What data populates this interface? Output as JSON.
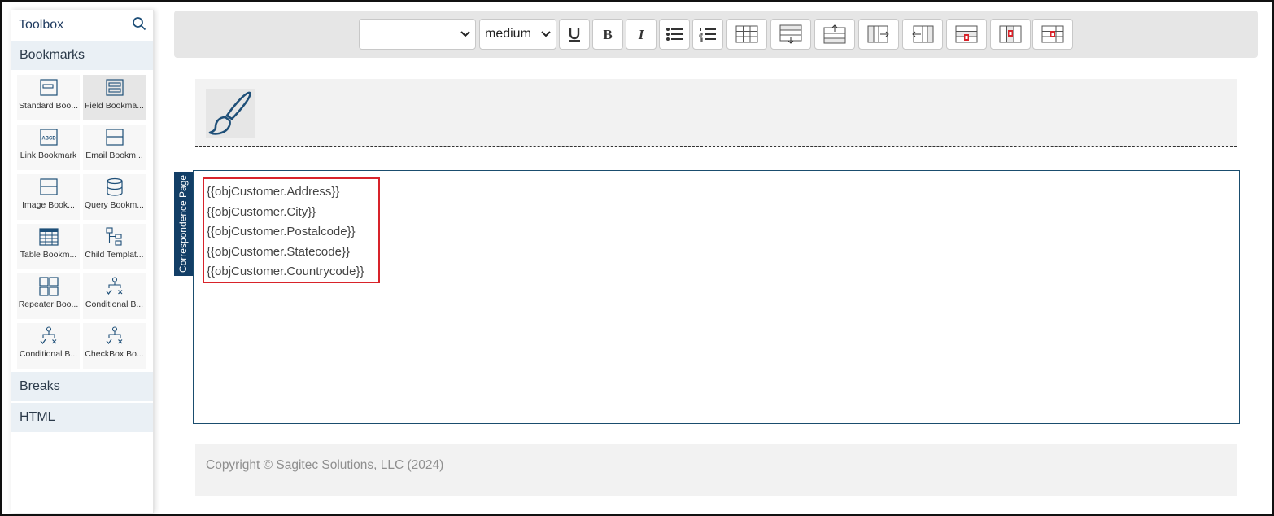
{
  "toolbox": {
    "title": "Toolbox",
    "sections": {
      "bookmarks": "Bookmarks",
      "breaks": "Breaks",
      "html": "HTML"
    },
    "items": [
      {
        "label": "Standard Boo...",
        "icon": "standard-bookmark-icon"
      },
      {
        "label": "Field Bookma...",
        "icon": "field-bookmark-icon"
      },
      {
        "label": "Link Bookmark",
        "icon": "link-bookmark-icon",
        "icon_text": "ABCD"
      },
      {
        "label": "Email Bookm...",
        "icon": "email-bookmark-icon"
      },
      {
        "label": "Image Book...",
        "icon": "image-bookmark-icon"
      },
      {
        "label": "Query Bookm...",
        "icon": "query-bookmark-icon"
      },
      {
        "label": "Table Bookm...",
        "icon": "table-bookmark-icon"
      },
      {
        "label": "Child Templat...",
        "icon": "child-template-icon"
      },
      {
        "label": "Repeater Boo...",
        "icon": "repeater-bookmark-icon"
      },
      {
        "label": "Conditional B...",
        "icon": "conditional-bookmark-icon"
      },
      {
        "label": "Conditional B...",
        "icon": "conditional-bookmark-icon"
      },
      {
        "label": "CheckBox Bo...",
        "icon": "checkbox-bookmark-icon"
      }
    ]
  },
  "toolbar": {
    "font_select_value": "",
    "size_select_value": "medium",
    "buttons": [
      "underline-icon",
      "bold-icon",
      "italic-icon",
      "bullet-list-icon",
      "numbered-list-icon",
      "insert-table-icon",
      "insert-row-below-icon",
      "insert-row-above-icon",
      "insert-column-right-icon",
      "insert-column-left-icon",
      "delete-row-icon",
      "delete-column-icon",
      "delete-table-icon"
    ]
  },
  "page": {
    "tab_label": "Correspondence Page",
    "content_lines": [
      "{{objCustomer.Address}}",
      "{{objCustomer.City}}",
      "{{objCustomer.Postalcode}}",
      "{{objCustomer.Statecode}}",
      "{{objCustomer.Countrycode}}"
    ],
    "footer": "Copyright © Sagitec Solutions, LLC (2024)"
  },
  "colors": {
    "accent": "#123e66",
    "highlight": "#d8232a",
    "icon": "#1e4f78"
  }
}
